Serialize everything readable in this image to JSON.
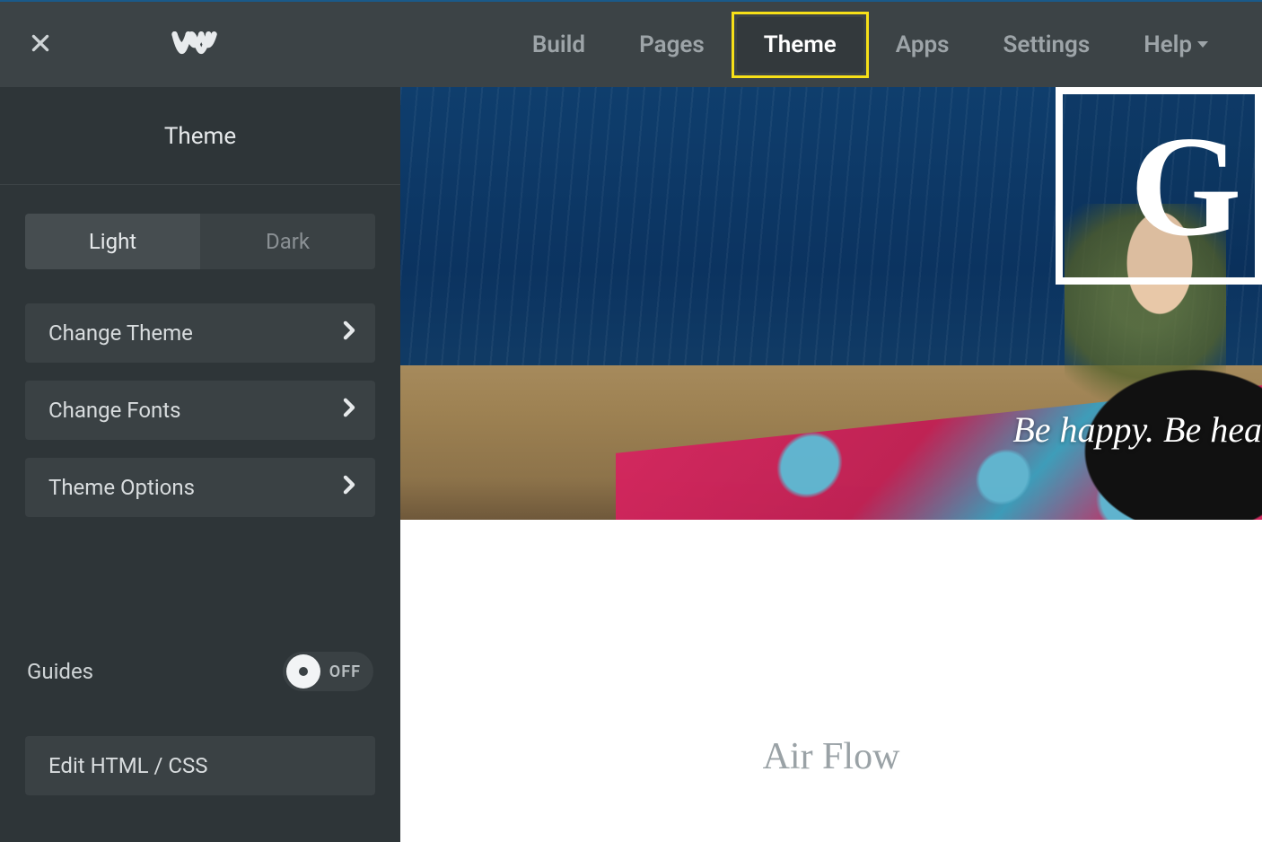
{
  "topbar": {
    "tabs": [
      {
        "label": "Build",
        "active": false
      },
      {
        "label": "Pages",
        "active": false
      },
      {
        "label": "Theme",
        "active": true
      },
      {
        "label": "Apps",
        "active": false
      },
      {
        "label": "Settings",
        "active": false
      },
      {
        "label": "Help",
        "active": false,
        "dropdown": true
      }
    ]
  },
  "sidebar": {
    "title": "Theme",
    "mode_toggle": {
      "options": [
        "Light",
        "Dark"
      ],
      "active": "Light"
    },
    "menu": [
      {
        "label": "Change Theme"
      },
      {
        "label": "Change Fonts"
      },
      {
        "label": "Theme Options"
      }
    ],
    "guides": {
      "label": "Guides",
      "state": "OFF"
    },
    "edit_code_label": "Edit HTML / CSS"
  },
  "preview": {
    "logo_letter": "G",
    "hero_tagline": "Be happy. Be hea",
    "section_title": "Air Flow"
  },
  "colors": {
    "highlight": "#f7e018",
    "topbar_bg": "#3c4346",
    "sidebar_bg": "#2e3538",
    "panel_bg": "#3a4144"
  }
}
